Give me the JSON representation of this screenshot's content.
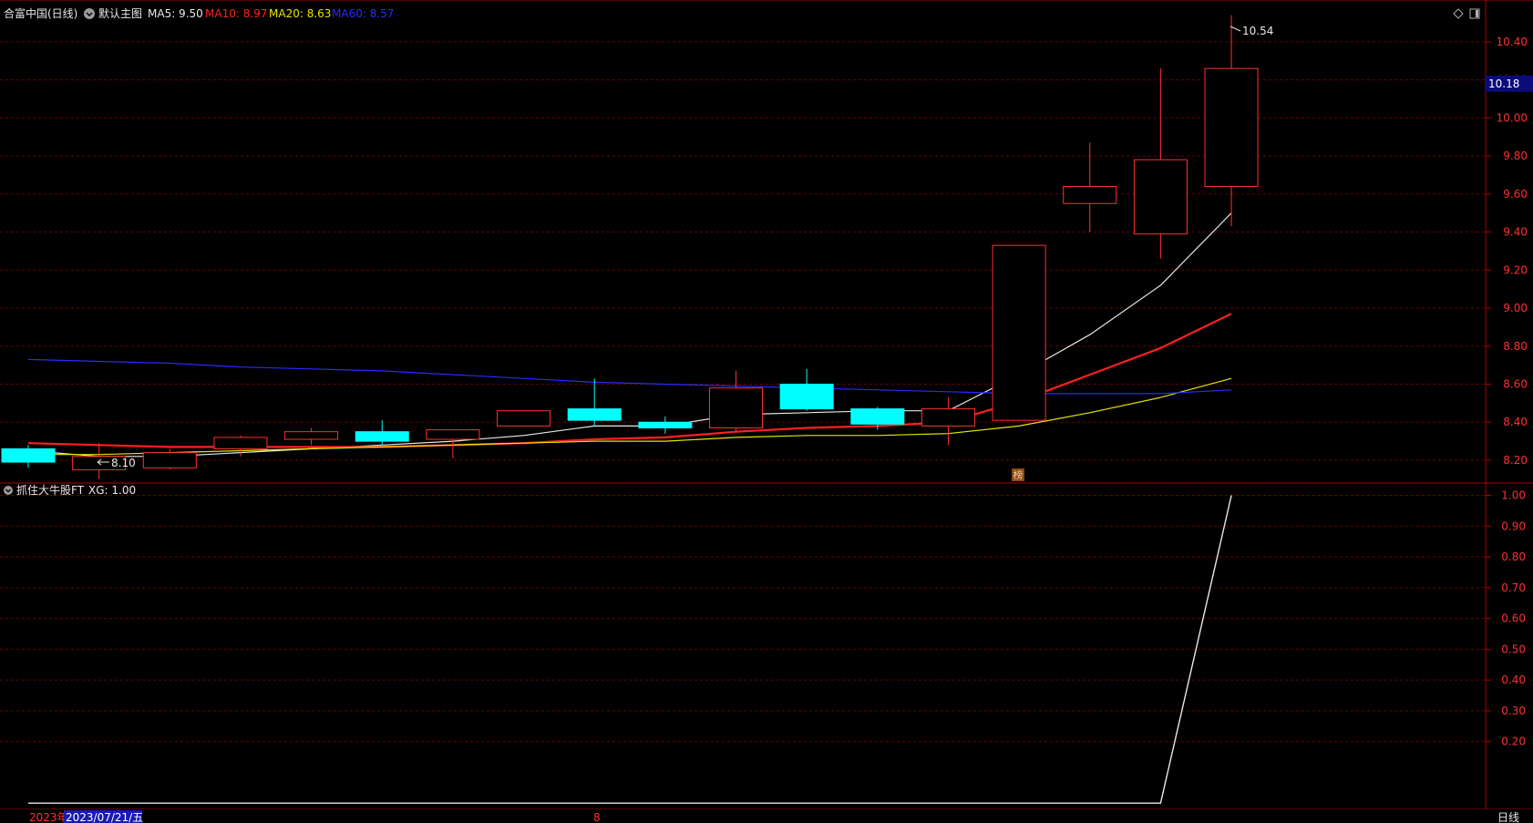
{
  "header": {
    "stock": "合富中国(日线)",
    "template": "默认主图",
    "ma": [
      {
        "label": "MA5: 9.50",
        "color": "#e8e8e8"
      },
      {
        "label": "MA10: 8.97",
        "color": "#ff2020"
      },
      {
        "label": "MA20: 8.63",
        "color": "#e6e600"
      },
      {
        "label": "MA60: 8.57",
        "color": "#2a2aff"
      }
    ]
  },
  "indicator_title": "抓住大牛股FT",
  "indicator_value": "XG: 1.00",
  "high_note": "10.54",
  "low_note": "8.10",
  "current_price": "10.18",
  "event_mark": "榜",
  "bottom": {
    "year": "2023年",
    "date": "2023/07/21/五",
    "month": "8",
    "period": "日线"
  },
  "colors": {
    "up": "#ff3030",
    "down": "#00ffff",
    "grid": "#6b0000",
    "axis": "#b00000"
  },
  "chart_data": [
    {
      "type": "candlestick",
      "ylim": [
        8.08,
        10.62
      ],
      "yticks": [
        8.2,
        8.4,
        8.6,
        8.8,
        9.0,
        9.2,
        9.4,
        9.6,
        9.8,
        10.0,
        10.2,
        10.4
      ],
      "candles": [
        {
          "o": 8.26,
          "h": 8.28,
          "l": 8.16,
          "c": 8.19
        },
        {
          "o": 8.15,
          "h": 8.29,
          "l": 8.1,
          "c": 8.22
        },
        {
          "o": 8.16,
          "h": 8.26,
          "l": 8.15,
          "c": 8.24
        },
        {
          "o": 8.26,
          "h": 8.33,
          "l": 8.22,
          "c": 8.32
        },
        {
          "o": 8.31,
          "h": 8.37,
          "l": 8.28,
          "c": 8.35
        },
        {
          "o": 8.35,
          "h": 8.41,
          "l": 8.28,
          "c": 8.3
        },
        {
          "o": 8.31,
          "h": 8.36,
          "l": 8.21,
          "c": 8.36
        },
        {
          "o": 8.38,
          "h": 8.46,
          "l": 8.38,
          "c": 8.46
        },
        {
          "o": 8.47,
          "h": 8.63,
          "l": 8.38,
          "c": 8.41
        },
        {
          "o": 8.4,
          "h": 8.43,
          "l": 8.34,
          "c": 8.37
        },
        {
          "o": 8.37,
          "h": 8.67,
          "l": 8.35,
          "c": 8.58
        },
        {
          "o": 8.6,
          "h": 8.68,
          "l": 8.46,
          "c": 8.47
        },
        {
          "o": 8.47,
          "h": 8.48,
          "l": 8.36,
          "c": 8.39
        },
        {
          "o": 8.38,
          "h": 8.53,
          "l": 8.28,
          "c": 8.47
        },
        {
          "o": 8.41,
          "h": 9.33,
          "l": 8.41,
          "c": 9.33
        },
        {
          "o": 9.55,
          "h": 9.87,
          "l": 9.4,
          "c": 9.64
        },
        {
          "o": 9.39,
          "h": 10.26,
          "l": 9.26,
          "c": 9.78
        },
        {
          "o": 9.64,
          "h": 10.54,
          "l": 9.43,
          "c": 10.26
        }
      ],
      "ma_series": [
        {
          "name": "MA5",
          "values": [
            8.25,
            8.22,
            8.22,
            8.24,
            8.26,
            8.28,
            8.3,
            8.33,
            8.38,
            8.38,
            8.44,
            8.45,
            8.46,
            8.46,
            8.65,
            8.86,
            9.12,
            9.5
          ]
        },
        {
          "name": "MA10",
          "values": [
            8.29,
            8.28,
            8.27,
            8.27,
            8.27,
            8.27,
            8.28,
            8.29,
            8.31,
            8.32,
            8.35,
            8.37,
            8.38,
            8.4,
            8.51,
            8.65,
            8.79,
            8.97
          ]
        },
        {
          "name": "MA20",
          "values": [
            8.23,
            8.23,
            8.24,
            8.25,
            8.26,
            8.27,
            8.28,
            8.29,
            8.3,
            8.3,
            8.32,
            8.33,
            8.33,
            8.34,
            8.38,
            8.45,
            8.53,
            8.63
          ]
        },
        {
          "name": "MA60",
          "values": [
            8.73,
            8.72,
            8.71,
            8.69,
            8.68,
            8.67,
            8.65,
            8.63,
            8.61,
            8.6,
            8.59,
            8.58,
            8.57,
            8.56,
            8.55,
            8.55,
            8.55,
            8.57
          ]
        }
      ]
    },
    {
      "type": "line",
      "ylim": [
        -0.02,
        1.04
      ],
      "yticks": [
        0.2,
        0.3,
        0.4,
        0.5,
        0.6,
        0.7,
        0.8,
        0.9,
        1.0
      ],
      "series": [
        {
          "name": "XG",
          "values": [
            0,
            0,
            0,
            0,
            0,
            0,
            0,
            0,
            0,
            0,
            0,
            0,
            0,
            0,
            0,
            0,
            0,
            1.0
          ]
        }
      ]
    }
  ]
}
